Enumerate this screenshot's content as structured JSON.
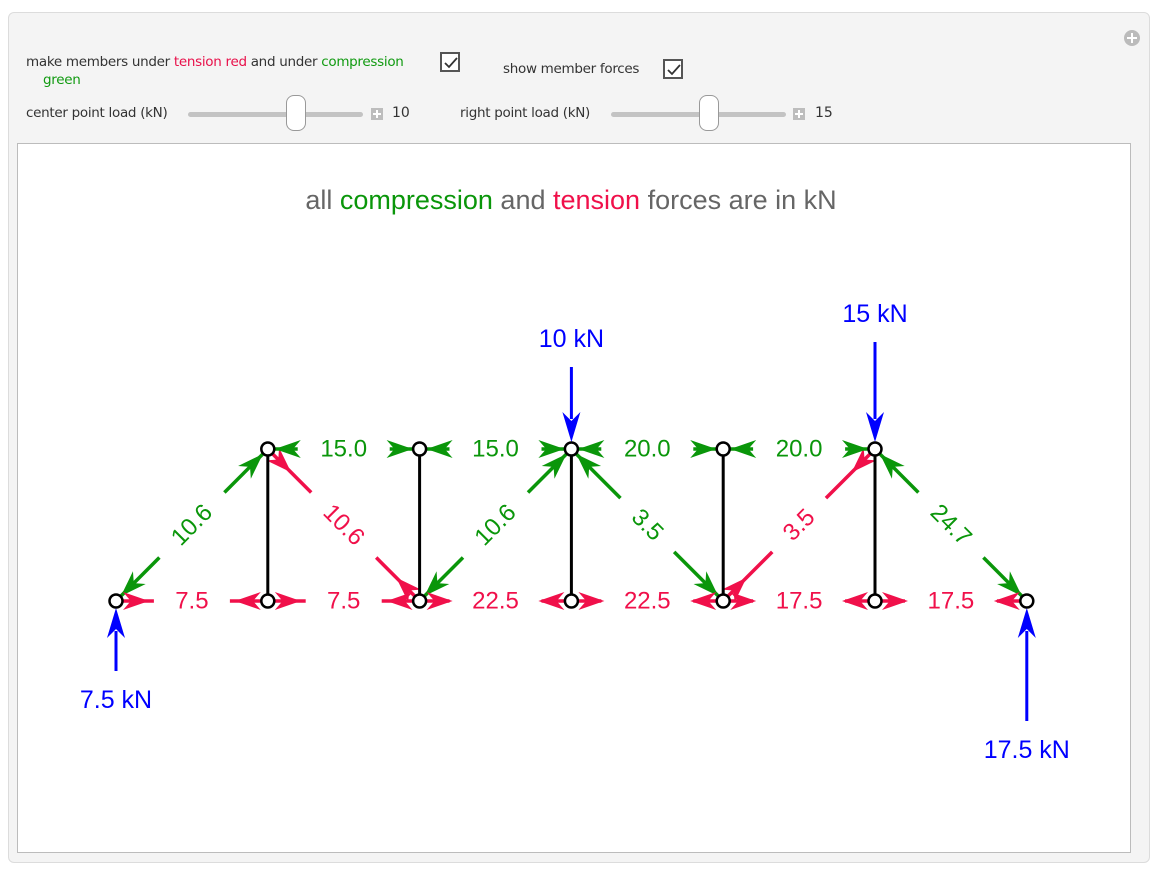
{
  "controls": {
    "color_toggle": {
      "label_prefix": "make members under ",
      "label_tension": "tension red",
      "label_mid": " and under ",
      "label_compression": "compression",
      "label_green": "green",
      "checked": true
    },
    "show_forces": {
      "label": "show member forces",
      "checked": true
    },
    "center_load": {
      "label": "center point load (kN)",
      "value": "10",
      "fraction": 0.63
    },
    "right_load": {
      "label": "right point load (kN)",
      "value": "15",
      "fraction": 0.57
    }
  },
  "plot": {
    "title_pre": "all ",
    "title_compression": "compression",
    "title_mid": " and ",
    "title_tension": "tension",
    "title_post": " forces are in kN"
  },
  "colors": {
    "compression": "#0a960a",
    "tension": "#f0104a",
    "load": "#0000ff",
    "member_zero": "#000000",
    "title_gray": "#666666"
  },
  "truss": {
    "nodes": {
      "B0": [
        0,
        0
      ],
      "B1": [
        1,
        0
      ],
      "B2": [
        2,
        0
      ],
      "B3": [
        3,
        0
      ],
      "B4": [
        4,
        0
      ],
      "B5": [
        5,
        0
      ],
      "B6": [
        6,
        0
      ],
      "T1": [
        1,
        1
      ],
      "T2": [
        2,
        1
      ],
      "T3": [
        3,
        1
      ],
      "T4": [
        4,
        1
      ],
      "T5": [
        5,
        1
      ]
    },
    "members": [
      {
        "from": "B0",
        "to": "T1",
        "force": "10.6",
        "type": "compression"
      },
      {
        "from": "T1",
        "to": "B2",
        "force": "10.6",
        "type": "tension"
      },
      {
        "from": "B2",
        "to": "T3",
        "force": "10.6",
        "type": "compression"
      },
      {
        "from": "T3",
        "to": "B4",
        "force": "3.5",
        "type": "compression"
      },
      {
        "from": "B4",
        "to": "T5",
        "force": "3.5",
        "type": "tension"
      },
      {
        "from": "T5",
        "to": "B6",
        "force": "24.7",
        "type": "compression"
      },
      {
        "from": "T1",
        "to": "T2",
        "force": "15.0",
        "type": "compression"
      },
      {
        "from": "T2",
        "to": "T3",
        "force": "15.0",
        "type": "compression"
      },
      {
        "from": "T3",
        "to": "T4",
        "force": "20.0",
        "type": "compression"
      },
      {
        "from": "T4",
        "to": "T5",
        "force": "20.0",
        "type": "compression"
      },
      {
        "from": "B0",
        "to": "B1",
        "force": "7.5",
        "type": "tension"
      },
      {
        "from": "B1",
        "to": "B2",
        "force": "7.5",
        "type": "tension"
      },
      {
        "from": "B2",
        "to": "B3",
        "force": "22.5",
        "type": "tension"
      },
      {
        "from": "B3",
        "to": "B4",
        "force": "22.5",
        "type": "tension"
      },
      {
        "from": "B4",
        "to": "B5",
        "force": "17.5",
        "type": "tension"
      },
      {
        "from": "B5",
        "to": "B6",
        "force": "17.5",
        "type": "tension"
      },
      {
        "from": "B1",
        "to": "T1",
        "force": "",
        "type": "zero"
      },
      {
        "from": "B2",
        "to": "T2",
        "force": "",
        "type": "zero"
      },
      {
        "from": "B3",
        "to": "T3",
        "force": "",
        "type": "zero"
      },
      {
        "from": "B4",
        "to": "T4",
        "force": "",
        "type": "zero"
      },
      {
        "from": "B5",
        "to": "T5",
        "force": "",
        "type": "zero"
      }
    ],
    "loads": [
      {
        "node": "T3",
        "label": "10 kN",
        "direction": "down"
      },
      {
        "node": "T5",
        "label": "15 kN",
        "direction": "down"
      }
    ],
    "reactions": [
      {
        "node": "B0",
        "label": "7.5 kN",
        "direction": "up"
      },
      {
        "node": "B6",
        "label": "17.5 kN",
        "direction": "up"
      }
    ]
  }
}
